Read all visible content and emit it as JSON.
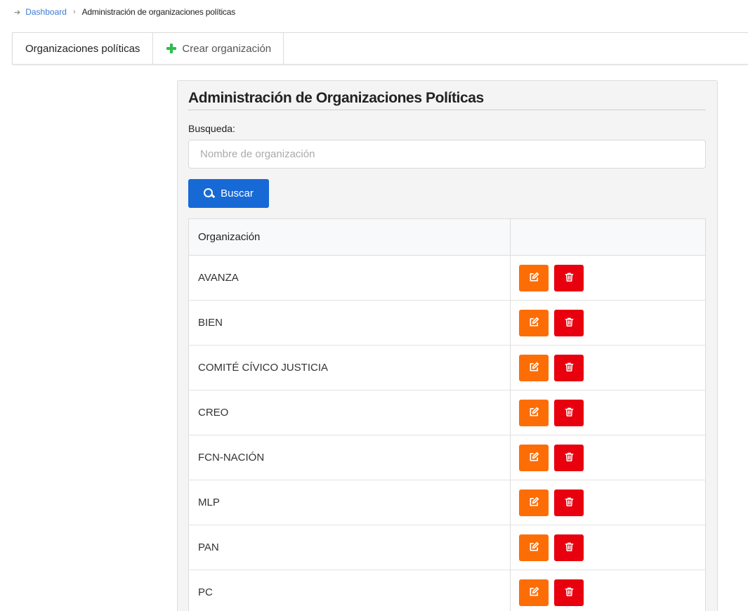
{
  "breadcrumb": {
    "home": "Dashboard",
    "current": "Administración de organizaciones políticas"
  },
  "tabs": [
    {
      "label": "Organizaciones políticas",
      "active": true
    },
    {
      "label": "Crear organización",
      "icon": "plus-icon"
    }
  ],
  "panel": {
    "title": "Administración de Organizaciones Políticas",
    "search_label": "Busqueda:",
    "search_placeholder": "Nombre de organización",
    "search_value": "",
    "search_button": "Buscar"
  },
  "table": {
    "columns": [
      "Organización",
      ""
    ],
    "rows": [
      {
        "name": "AVANZA"
      },
      {
        "name": "BIEN"
      },
      {
        "name": "COMITÉ CÍVICO JUSTICIA"
      },
      {
        "name": "CREO"
      },
      {
        "name": "FCN-NACIÓN"
      },
      {
        "name": "MLP"
      },
      {
        "name": "PAN"
      },
      {
        "name": "PC"
      }
    ]
  },
  "colors": {
    "accent_blue": "#1769d6",
    "edit_orange": "#fd6d05",
    "delete_red": "#e8000e",
    "plus_green": "#2ebd4e"
  }
}
